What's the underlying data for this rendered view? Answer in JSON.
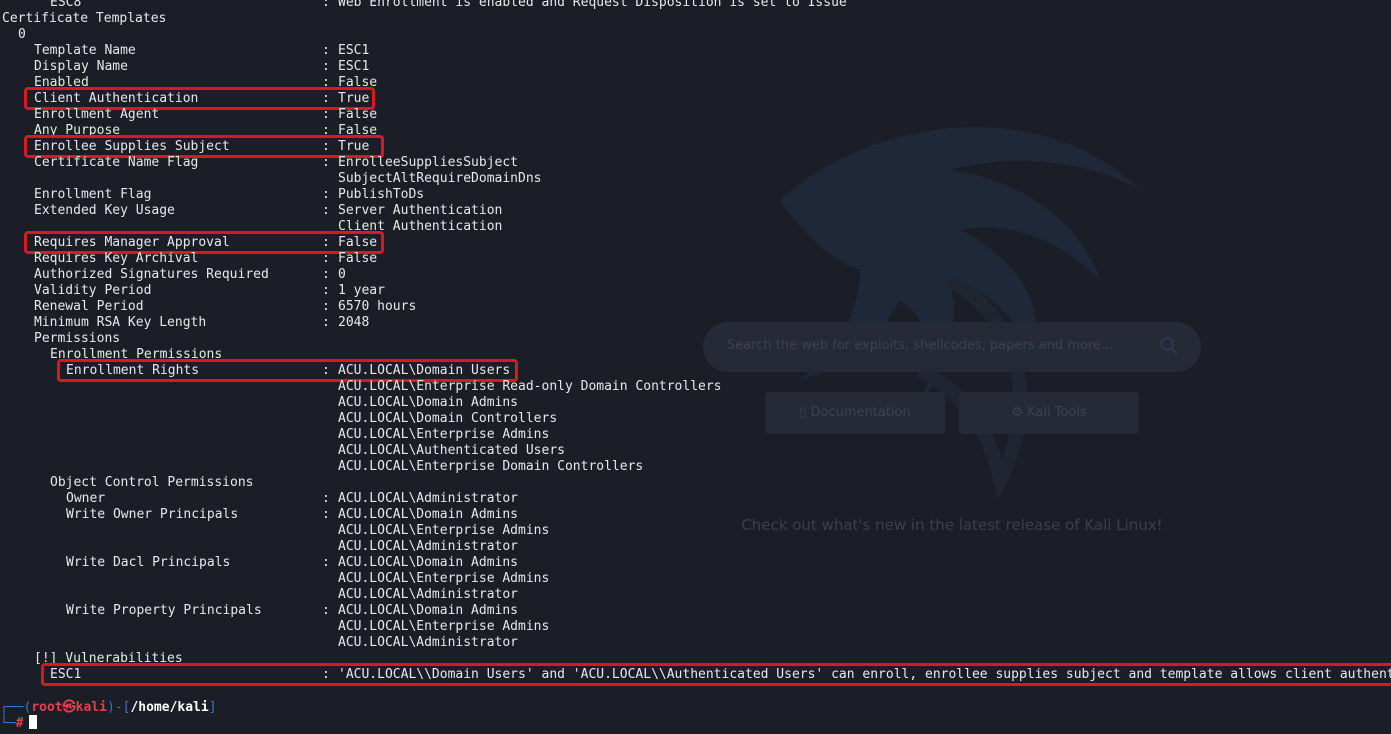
{
  "background": {
    "search_placeholder": "Search the web for exploits, shellcodes, papers and more...",
    "documentation_button": "Documentation",
    "kali_tools_button": "Kali Tools",
    "news_text": "Check out what's new in the latest release of Kali Linux!"
  },
  "terminal": {
    "lines": [
      {
        "indent": 6,
        "key": "ESC8",
        "value": "Web Enrollment is enabled and Request Disposition is set to Issue"
      },
      {
        "indent": 0,
        "key": "Certificate Templates",
        "value": null
      },
      {
        "indent": 2,
        "key": "0",
        "value": null
      },
      {
        "indent": 4,
        "key": "Template Name",
        "value": "ESC1"
      },
      {
        "indent": 4,
        "key": "Display Name",
        "value": "ESC1"
      },
      {
        "indent": 4,
        "key": "Enabled",
        "value": "False"
      },
      {
        "indent": 4,
        "key": "Client Authentication",
        "value": "True"
      },
      {
        "indent": 4,
        "key": "Enrollment Agent",
        "value": "False"
      },
      {
        "indent": 4,
        "key": "Any Purpose",
        "value": "False"
      },
      {
        "indent": 4,
        "key": "Enrollee Supplies Subject",
        "value": "True"
      },
      {
        "indent": 4,
        "key": "Certificate Name Flag",
        "value": "EnrolleeSuppliesSubject"
      },
      {
        "indent": 4,
        "key": "",
        "value": "SubjectAltRequireDomainDns",
        "cont": true
      },
      {
        "indent": 4,
        "key": "Enrollment Flag",
        "value": "PublishToDs"
      },
      {
        "indent": 4,
        "key": "Extended Key Usage",
        "value": "Server Authentication"
      },
      {
        "indent": 4,
        "key": "",
        "value": "Client Authentication",
        "cont": true
      },
      {
        "indent": 4,
        "key": "Requires Manager Approval",
        "value": "False"
      },
      {
        "indent": 4,
        "key": "Requires Key Archival",
        "value": "False"
      },
      {
        "indent": 4,
        "key": "Authorized Signatures Required",
        "value": "0"
      },
      {
        "indent": 4,
        "key": "Validity Period",
        "value": "1 year"
      },
      {
        "indent": 4,
        "key": "Renewal Period",
        "value": "6570 hours"
      },
      {
        "indent": 4,
        "key": "Minimum RSA Key Length",
        "value": "2048"
      },
      {
        "indent": 4,
        "key": "Permissions",
        "value": null
      },
      {
        "indent": 6,
        "key": "Enrollment Permissions",
        "value": null
      },
      {
        "indent": 8,
        "key": "Enrollment Rights",
        "value": "ACU.LOCAL\\Domain Users"
      },
      {
        "indent": 8,
        "key": "",
        "value": "ACU.LOCAL\\Enterprise Read-only Domain Controllers",
        "cont": true
      },
      {
        "indent": 8,
        "key": "",
        "value": "ACU.LOCAL\\Domain Admins",
        "cont": true
      },
      {
        "indent": 8,
        "key": "",
        "value": "ACU.LOCAL\\Domain Controllers",
        "cont": true
      },
      {
        "indent": 8,
        "key": "",
        "value": "ACU.LOCAL\\Enterprise Admins",
        "cont": true
      },
      {
        "indent": 8,
        "key": "",
        "value": "ACU.LOCAL\\Authenticated Users",
        "cont": true
      },
      {
        "indent": 8,
        "key": "",
        "value": "ACU.LOCAL\\Enterprise Domain Controllers",
        "cont": true
      },
      {
        "indent": 6,
        "key": "Object Control Permissions",
        "value": null
      },
      {
        "indent": 8,
        "key": "Owner",
        "value": "ACU.LOCAL\\Administrator"
      },
      {
        "indent": 8,
        "key": "Write Owner Principals",
        "value": "ACU.LOCAL\\Domain Admins"
      },
      {
        "indent": 8,
        "key": "",
        "value": "ACU.LOCAL\\Enterprise Admins",
        "cont": true
      },
      {
        "indent": 8,
        "key": "",
        "value": "ACU.LOCAL\\Administrator",
        "cont": true
      },
      {
        "indent": 8,
        "key": "Write Dacl Principals",
        "value": "ACU.LOCAL\\Domain Admins"
      },
      {
        "indent": 8,
        "key": "",
        "value": "ACU.LOCAL\\Enterprise Admins",
        "cont": true
      },
      {
        "indent": 8,
        "key": "",
        "value": "ACU.LOCAL\\Administrator",
        "cont": true
      },
      {
        "indent": 8,
        "key": "Write Property Principals",
        "value": "ACU.LOCAL\\Domain Admins"
      },
      {
        "indent": 8,
        "key": "",
        "value": "ACU.LOCAL\\Enterprise Admins",
        "cont": true
      },
      {
        "indent": 8,
        "key": "",
        "value": "ACU.LOCAL\\Administrator",
        "cont": true
      },
      {
        "indent": 4,
        "key": "[!] Vulnerabilities",
        "value": null
      },
      {
        "indent": 6,
        "key": "ESC1",
        "value": "'ACU.LOCAL\\\\Domain Users' and 'ACU.LOCAL\\\\Authenticated Users' can enroll, enrollee supplies subject and template allows client authentication"
      }
    ],
    "highlighted": [
      "Client Authentication",
      "Enrollee Supplies Subject",
      "Requires Manager Approval",
      "Enrollment Rights",
      "ESC1-vuln"
    ],
    "prompt": {
      "user": "root",
      "symbol": "㉿",
      "host": "kali",
      "path": "/home/kali",
      "hash": "#"
    }
  },
  "colors": {
    "background": "#1b1e27",
    "text": "#e8e8e8",
    "highlight_box": "#e0161b",
    "prompt_blue": "#3d73c5",
    "prompt_red": "#e5404a"
  }
}
